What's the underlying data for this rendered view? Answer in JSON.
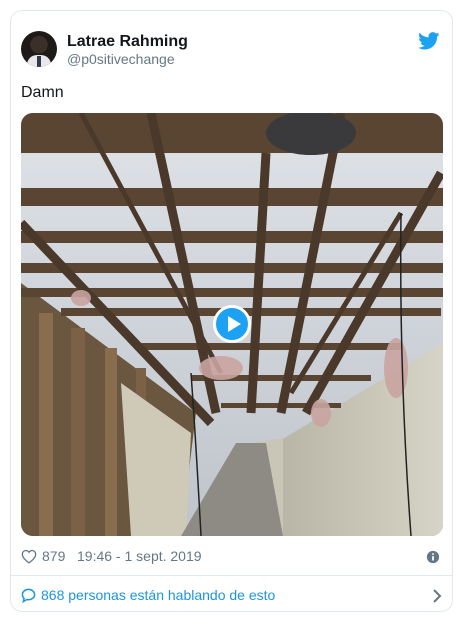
{
  "author": {
    "display_name": "Latrae Rahming",
    "handle": "@p0sitivechange"
  },
  "tweet": {
    "text": "Damn"
  },
  "media": {
    "type": "video"
  },
  "meta": {
    "likes": "879",
    "timestamp": "19:46 - 1 sept. 2019"
  },
  "footer": {
    "conversation": "868 personas están hablando de esto"
  },
  "colors": {
    "twitter_blue": "#1da1f2",
    "link_blue": "#1b95e0",
    "muted_gray": "#657786",
    "border": "#e1e8ed"
  },
  "icons": [
    "twitter-bird-icon",
    "play-icon",
    "heart-icon",
    "info-icon",
    "chat-bubble-icon",
    "chevron-right-icon"
  ]
}
